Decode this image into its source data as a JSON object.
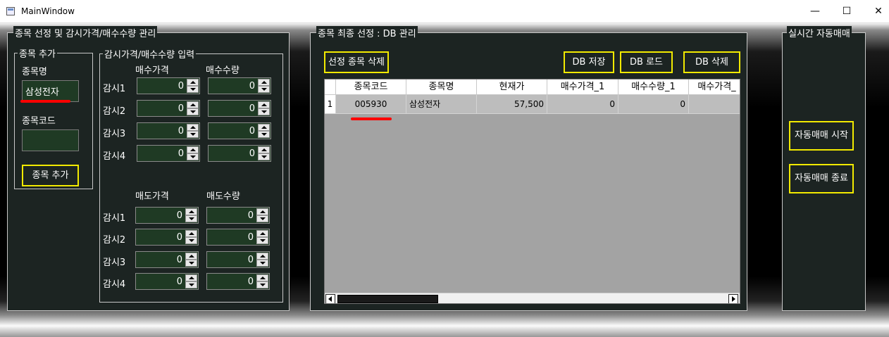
{
  "window": {
    "title": "MainWindow"
  },
  "left_group": {
    "title": "종목 선정 및 감시가격/매수수량 관리",
    "add_group": {
      "title": "종목 추가",
      "name_label": "종목명",
      "name_value": "삼성전자",
      "code_label": "종목코드",
      "code_value": "",
      "add_button": "종목 추가"
    },
    "price_group": {
      "title": "감시가격/매수수량 입력",
      "buy_price_header": "매수가격",
      "buy_qty_header": "매수수량",
      "sell_price_header": "매도가격",
      "sell_qty_header": "매도수량",
      "rows": [
        "감시1",
        "감시2",
        "감시3",
        "감시4"
      ],
      "buy_prices": [
        "0",
        "0",
        "0",
        "0"
      ],
      "buy_qtys": [
        "0",
        "0",
        "0",
        "0"
      ],
      "sell_prices": [
        "0",
        "0",
        "0",
        "0"
      ],
      "sell_qtys": [
        "0",
        "0",
        "0",
        "0"
      ]
    }
  },
  "middle_group": {
    "title": "종목 최종 선정 : DB 관리",
    "delete_selected_button": "선정 종목 삭제",
    "db_save_button": "DB 저장",
    "db_load_button": "DB 로드",
    "db_delete_button": "DB 삭제",
    "table": {
      "columns": [
        "종목코드",
        "종목명",
        "현재가",
        "매수가격_1",
        "매수수량_1",
        "매수가격_"
      ],
      "rows": [
        {
          "index": "1",
          "cells": [
            "005930",
            "삼성전자",
            "57,500",
            "0",
            "0",
            ""
          ]
        }
      ]
    }
  },
  "right_group": {
    "title": "실시간 자동매매",
    "start_button": "자동매매 시작",
    "stop_button": "자동매매 종료"
  }
}
